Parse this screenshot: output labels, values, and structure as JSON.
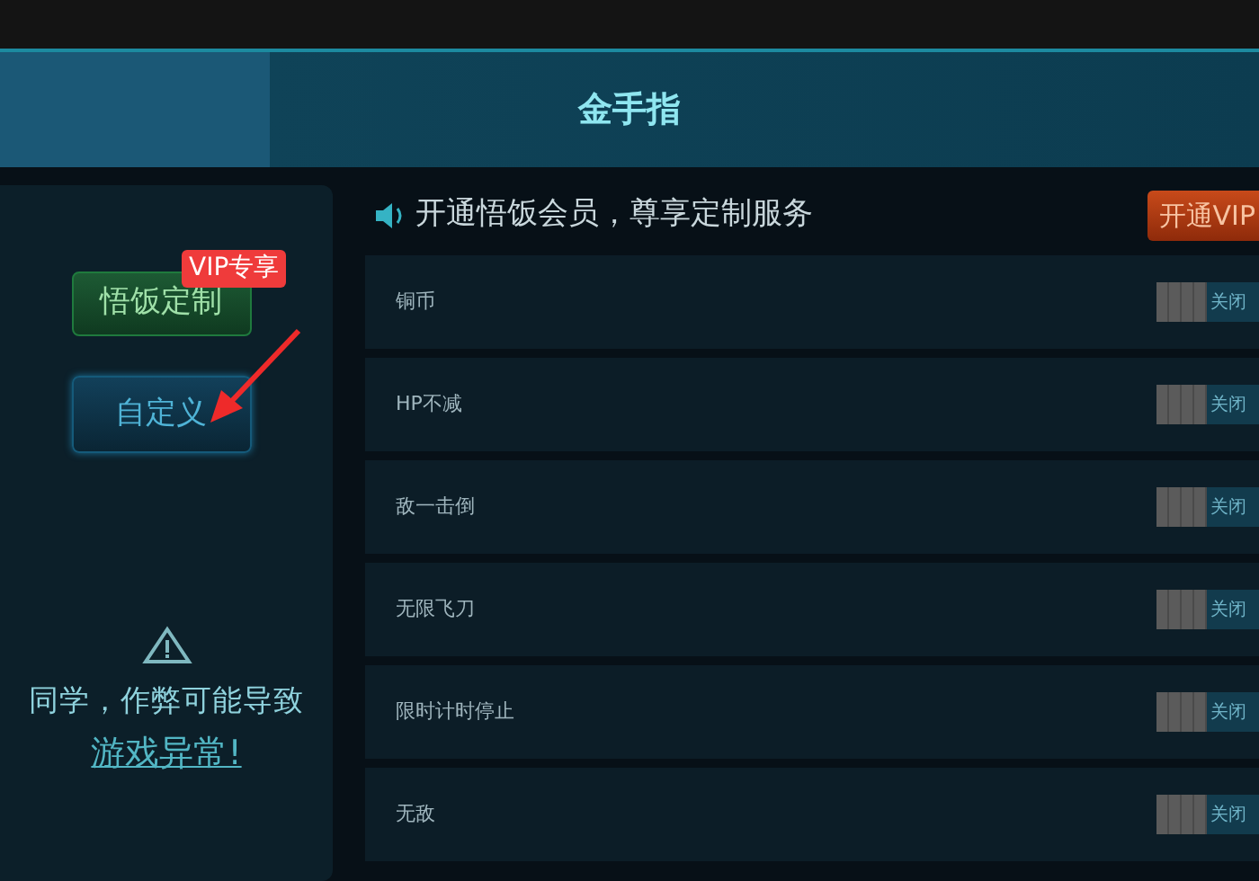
{
  "header": {
    "title": "金手指"
  },
  "sidebar": {
    "buttons": [
      {
        "label": "悟饭定制",
        "kind": "vip",
        "badge": "VIP专享",
        "selected": false
      },
      {
        "label": "自定义",
        "kind": "custom",
        "selected": true
      }
    ],
    "warning": {
      "line_1": "同学，作弊可能导致",
      "line_2": "游戏异常!"
    }
  },
  "promo": {
    "text": "开通悟饭会员，尊享定制服务",
    "button": "开通VIP"
  },
  "cheats": [
    {
      "name": "铜币",
      "on": false,
      "state_label": "关闭"
    },
    {
      "name": "HP不减",
      "on": false,
      "state_label": "关闭"
    },
    {
      "name": "敌一击倒",
      "on": false,
      "state_label": "关闭"
    },
    {
      "name": "无限飞刀",
      "on": false,
      "state_label": "关闭"
    },
    {
      "name": "限时计时停止",
      "on": false,
      "state_label": "关闭"
    },
    {
      "name": "无敌",
      "on": false,
      "state_label": "关闭"
    }
  ]
}
